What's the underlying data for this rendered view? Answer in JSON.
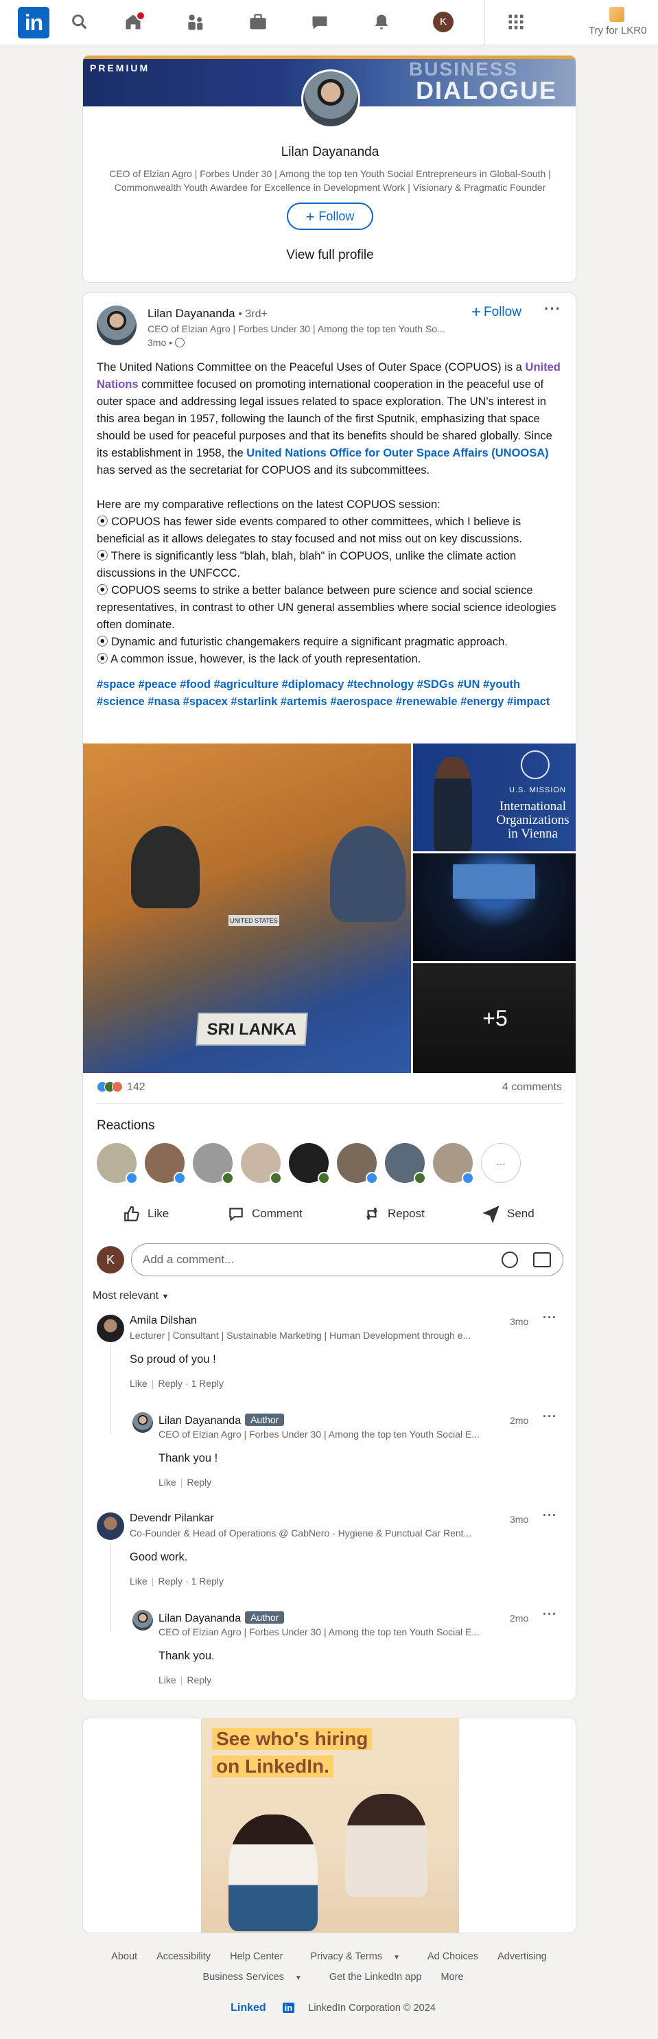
{
  "nav": {
    "logo": "in",
    "premium_label": "Try for LKR0",
    "avatar_initial": "K"
  },
  "profile_card": {
    "premium_badge": "PREMIUM",
    "banner_text_1": "BUSINESS",
    "banner_text_2": "DIALOGUE",
    "name": "Lilan Dayananda",
    "headline": "CEO of Elzian Agro | Forbes Under 30 | Among the top ten Youth Social Entrepreneurs in Global-South | Commonwealth Youth Awardee for Excellence in Development Work | Visionary & Pragmatic Founder",
    "follow_label": "Follow",
    "view_profile_label": "View full profile"
  },
  "post": {
    "author": "Lilan Dayananda",
    "degree": "• 3rd+",
    "subtitle": "CEO of Elzian Agro | Forbes Under 30 | Among the top ten Youth So...",
    "time": "3mo •",
    "follow_label": "Follow",
    "para1_a": "The United Nations Committee on the Peaceful Uses of Outer Space (COPUOS) is a ",
    "para1_link1": "United Nations",
    "para1_b": " committee focused on promoting international cooperation in the peaceful use of outer space and addressing legal issues related to space exploration. The UN's interest in this area began in 1957, following the launch of the first Sputnik, emphasizing that space should be used for peaceful purposes and that its benefits should be shared globally. Since its establishment in 1958, the ",
    "para1_link2": "United Nations Office for Outer Space Affairs (UNOOSA)",
    "para1_c": " has served as the secretariat for COPUOS and its subcommittees.",
    "intro": "Here are my comparative reflections on the latest COPUOS session:",
    "bullets": [
      "⦿ COPUOS has fewer side events compared to other committees, which I believe is beneficial as it allows delegates to stay focused and not miss out on key discussions.",
      "⦿ There is significantly less \"blah, blah, blah\" in COPUOS, unlike the climate action discussions in the UNFCCC.",
      "⦿ COPUOS seems to strike a better balance between pure science and social science representatives, in contrast to other UN general assemblies where social science ideologies often dominate.",
      "⦿ Dynamic and futuristic changemakers require a significant pragmatic approach.",
      "⦿ A common issue, however, is the lack of youth representation."
    ],
    "hashtags": "#space #peace #food #agriculture #diplomacy #technology #SDGs #UN #youth #science #nasa #spacex #starlink #artemis #aerospace #renewable #energy #impact",
    "image_sign": "SRI LANKA",
    "image_sign_small": "UNITED STATES",
    "image_r1_small": "U.S. MISSION",
    "image_r1_big": "International Organizations in Vienna",
    "more_images": "+5",
    "reaction_count": "142",
    "comments_count": "4 comments",
    "reactions_label": "Reactions",
    "reactions_more": "...",
    "actions": [
      "Like",
      "Comment",
      "Repost",
      "Send"
    ],
    "comment_placeholder": "Add a comment...",
    "my_initial": "K",
    "sort_label": "Most relevant"
  },
  "comments": [
    {
      "name": "Amila Dilshan",
      "headline": "Lecturer | Consultant | Sustainable Marketing | Human Development through e...",
      "time": "3mo",
      "text": "So proud of you !",
      "like": "Like",
      "reply": "Reply",
      "replies": "· 1 Reply"
    },
    {
      "name": "Lilan Dayananda",
      "author_badge": "Author",
      "headline": "CEO of Elzian Agro | Forbes Under 30 | Among the top ten Youth Social E...",
      "time": "2mo",
      "text": "Thank you !",
      "like": "Like",
      "reply": "Reply"
    },
    {
      "name": "Devendr Pilankar",
      "headline": "Co-Founder & Head of Operations @ CabNero - Hygiene & Punctual Car Rent...",
      "time": "3mo",
      "text": "Good work.",
      "like": "Like",
      "reply": "Reply",
      "replies": "· 1 Reply"
    },
    {
      "name": "Lilan Dayananda",
      "author_badge": "Author",
      "headline": "CEO of Elzian Agro | Forbes Under 30 | Among the top ten Youth Social E...",
      "time": "2mo",
      "text": "Thank you.",
      "like": "Like",
      "reply": "Reply"
    }
  ],
  "ad": {
    "line1": "See who's hiring",
    "line2": "on LinkedIn."
  },
  "footer": {
    "links_row1": [
      "About",
      "Accessibility",
      "Help Center",
      "Privacy & Terms",
      "Ad Choices",
      "Advertising"
    ],
    "links_row2": [
      "Business Services",
      "Get the LinkedIn app",
      "More"
    ],
    "brand": "Linked",
    "brand_in": "in",
    "copyright": "LinkedIn Corporation © 2024"
  },
  "colors": {
    "brand": "#0a66c2",
    "premium_gold": "#e7a33e",
    "notification": "#cb112d",
    "author_badge": "#56687a"
  }
}
